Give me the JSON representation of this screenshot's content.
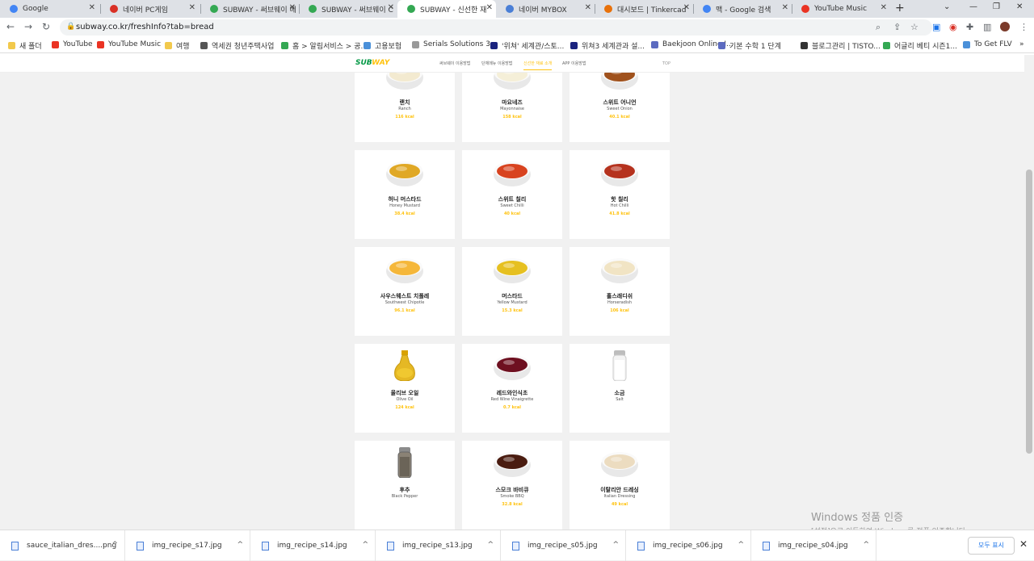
{
  "browser": {
    "tabs": [
      {
        "title": "Google",
        "color": "#4285f4",
        "active": false
      },
      {
        "title": "네이버 PC게임",
        "color": "#d93025",
        "active": false
      },
      {
        "title": "SUBWAY - 써브웨이 메",
        "color": "#34a853",
        "active": false
      },
      {
        "title": "SUBWAY - 써브웨이 C",
        "color": "#34a853",
        "active": false
      },
      {
        "title": "SUBWAY - 신선한 재",
        "color": "#34a853",
        "active": true
      },
      {
        "title": "네이버 MYBOX",
        "color": "#4a7fd6",
        "active": false
      },
      {
        "title": "대시보드 | Tinkercad",
        "color": "#e8710a",
        "active": false
      },
      {
        "title": "맥 - Google 검색",
        "color": "#4285f4",
        "active": false
      },
      {
        "title": "YouTube Music",
        "color": "#ea3323",
        "active": false
      }
    ],
    "new_tab": "+",
    "url": "subway.co.kr/freshInfo?tab=bread",
    "bookmarks": [
      {
        "label": "새 폴더",
        "color": "#f2c94c"
      },
      {
        "label": "YouTube",
        "color": "#ea3323"
      },
      {
        "label": "YouTube Music",
        "color": "#ea3323"
      },
      {
        "label": "여행",
        "color": "#f2c94c"
      },
      {
        "label": "역세권 청년주택사업",
        "color": "#555555"
      },
      {
        "label": "홈 > 알림서비스 > 공...",
        "color": "#34a853"
      },
      {
        "label": "고용보험",
        "color": "#4a90d9"
      },
      {
        "label": "Serials Solutions 3...",
        "color": "#999999"
      },
      {
        "label": "'위쳐' 세계관/스토...",
        "color": "#1a237e"
      },
      {
        "label": "위쳐3 세계관과 설...",
        "color": "#1a237e"
      },
      {
        "label": "Baekjoon Online J...",
        "color": "#5c6bc0"
      },
      {
        "label": "기본 수학 1 단계",
        "color": "#5c6bc0"
      },
      {
        "label": "블로그관리 | TISTO...",
        "color": "#333333"
      },
      {
        "label": "어글리 베티 시즌1...",
        "color": "#34a853"
      },
      {
        "label": "To Get FLV",
        "color": "#4a90d9"
      }
    ]
  },
  "site": {
    "logo_a": "SUB",
    "logo_b": "WAY",
    "nav": [
      {
        "label": "써브웨이 이용방법",
        "active": false
      },
      {
        "label": "단체메뉴 이용방법",
        "active": false
      },
      {
        "label": "신선한 재료 소개",
        "active": true
      },
      {
        "label": "APP 이용방법",
        "active": false
      }
    ],
    "top_label": "TOP"
  },
  "sauces": [
    {
      "kname": "랜치",
      "ename": "Ranch",
      "kcal": "116 kcal",
      "color": "#f3ead0",
      "icon": "sauce-bowl-icon"
    },
    {
      "kname": "마요네즈",
      "ename": "Mayonnaise",
      "kcal": "158 kcal",
      "color": "#f5efd8",
      "icon": "sauce-bowl-icon"
    },
    {
      "kname": "스위트 어니언",
      "ename": "Sweet Onion",
      "kcal": "40.1 kcal",
      "color": "#a0521d",
      "icon": "sauce-bowl-icon"
    },
    {
      "kname": "허니 머스타드",
      "ename": "Honey Mustard",
      "kcal": "38.4 kcal",
      "color": "#e0a825",
      "icon": "sauce-bowl-icon"
    },
    {
      "kname": "스위트 칠리",
      "ename": "Sweet Chilli",
      "kcal": "40 kcal",
      "color": "#d8431f",
      "icon": "sauce-bowl-icon"
    },
    {
      "kname": "핫 칠리",
      "ename": "Hot Chilli",
      "kcal": "41.8 kcal",
      "color": "#b5321e",
      "icon": "sauce-bowl-icon"
    },
    {
      "kname": "사우스웨스트 치폴레",
      "ename": "Southwest Chipotle",
      "kcal": "96.1 kcal",
      "color": "#f5b73a",
      "icon": "sauce-bowl-icon"
    },
    {
      "kname": "머스타드",
      "ename": "Yellow Mustard",
      "kcal": "15.3 kcal",
      "color": "#e6c020",
      "icon": "sauce-bowl-icon"
    },
    {
      "kname": "홀스래디쉬",
      "ename": "Horseradish",
      "kcal": "106 kcal",
      "color": "#f1e4c4",
      "icon": "sauce-bowl-icon"
    },
    {
      "kname": "올리브 오일",
      "ename": "Olive Oil",
      "kcal": "124 kcal",
      "color": "#e5b824",
      "icon": "oil-bottle-icon"
    },
    {
      "kname": "레드와인식초",
      "ename": "Red Wine Vinaigrette",
      "kcal": "0.7 kcal",
      "color": "#6e1020",
      "icon": "sauce-bowl-icon"
    },
    {
      "kname": "소금",
      "ename": "Salt",
      "kcal": "",
      "color": "#e8e8e8",
      "icon": "salt-shaker-icon"
    },
    {
      "kname": "후추",
      "ename": "Black Pepper",
      "kcal": "",
      "color": "#8a8275",
      "icon": "pepper-shaker-icon"
    },
    {
      "kname": "스모크 바비큐",
      "ename": "Smoke BBQ",
      "kcal": "32.8 kcal",
      "color": "#4a1c10",
      "icon": "sauce-bowl-icon"
    },
    {
      "kname": "이탈리안 드레싱",
      "ename": "Italian Dressing",
      "kcal": "49 kcal",
      "color": "#ecdcc0",
      "icon": "sauce-bowl-icon"
    }
  ],
  "watermark": {
    "line1": "Windows 정품 인증",
    "line2": "[설정]으로 이동하여 Windows를 정품 인증합니다."
  },
  "downloads": {
    "items": [
      "sauce_italian_dres....png",
      "img_recipe_s17.jpg",
      "img_recipe_s14.jpg",
      "img_recipe_s13.jpg",
      "img_recipe_s05.jpg",
      "img_recipe_s06.jpg",
      "img_recipe_s04.jpg"
    ],
    "show_all": "모두 표시"
  }
}
